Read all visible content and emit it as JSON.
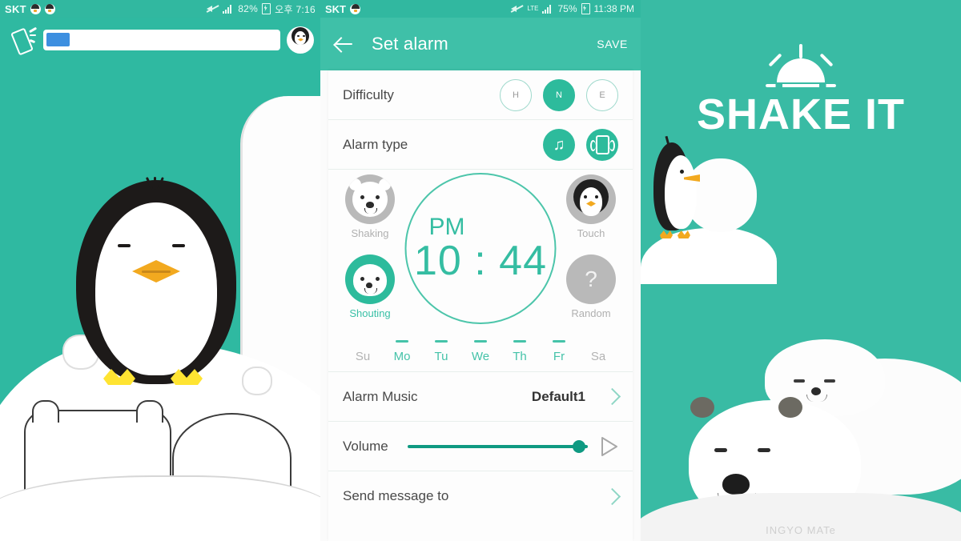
{
  "left_panel": {
    "status_bar": {
      "carrier": "SKT",
      "battery": "82%",
      "time": "오후 7:16",
      "icons": [
        "penguin-badge-icon",
        "penguin-badge-icon",
        "mute-icon",
        "signal-icon",
        "battery-charging-icon"
      ]
    },
    "toolbar": {
      "shake_icon": "shaking-phone-icon",
      "progress_percent": 10,
      "avatar_icon": "penguin-avatar-icon"
    },
    "illustration": "penguin-on-iceberg-with-snowballs"
  },
  "phone": {
    "status_bar": {
      "carrier": "SKT",
      "network": "LTE",
      "battery": "75%",
      "time": "11:38 PM"
    },
    "appbar": {
      "back_icon": "back-arrow-icon",
      "title": "Set alarm",
      "save_label": "SAVE"
    },
    "difficulty": {
      "label": "Difficulty",
      "options": [
        {
          "code": "H",
          "selected": false
        },
        {
          "code": "N",
          "selected": true
        },
        {
          "code": "E",
          "selected": false
        }
      ]
    },
    "alarm_type": {
      "label": "Alarm type",
      "options": [
        {
          "icon": "music-note-icon",
          "selected": true
        },
        {
          "icon": "vibrate-icon",
          "selected": true
        }
      ]
    },
    "missions": [
      {
        "id": "shaking",
        "label": "Shaking",
        "icon": "polar-bear-icon",
        "selected": false
      },
      {
        "id": "shouting",
        "label": "Shouting",
        "icon": "seal-icon",
        "selected": true
      },
      {
        "id": "touch",
        "label": "Touch",
        "icon": "penguin-icon",
        "selected": false
      },
      {
        "id": "random",
        "label": "Random",
        "icon": "question-mark-icon",
        "selected": false
      }
    ],
    "clock": {
      "meridiem": "PM",
      "hour": "10",
      "separator": ":",
      "minute": "44"
    },
    "days": [
      {
        "label": "Su",
        "selected": false
      },
      {
        "label": "Mo",
        "selected": true
      },
      {
        "label": "Tu",
        "selected": true
      },
      {
        "label": "We",
        "selected": true
      },
      {
        "label": "Th",
        "selected": true
      },
      {
        "label": "Fr",
        "selected": true
      },
      {
        "label": "Sa",
        "selected": false
      }
    ],
    "alarm_music": {
      "label": "Alarm Music",
      "value": "Default1",
      "chevron_icon": "chevron-right-icon"
    },
    "volume": {
      "label": "Volume",
      "level_percent": 95,
      "preview_icon": "play-triangle-icon"
    },
    "send_message": {
      "label": "Send message to",
      "chevron_icon": "chevron-right-icon"
    }
  },
  "right_panel": {
    "logo_icon": "sunrise-icon",
    "logo_text": "SHAKE IT",
    "watermark": "INGYO MATe",
    "illustration": "penguin-with-snowball-and-sleeping-polar-bear-with-seal"
  },
  "colors": {
    "brand_teal": "#33b9a2",
    "appbar_teal": "#3fc0a8",
    "accent_green": "#2dbb9c",
    "slider_green": "#0f9a82",
    "progress_blue": "#3d8fe0",
    "beak_orange": "#f2a91f",
    "muted_gray": "#b0b0b0"
  }
}
